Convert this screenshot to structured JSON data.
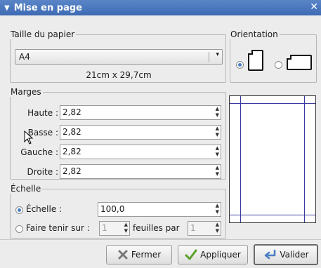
{
  "window": {
    "title": "Mise en page",
    "close_glyph": "✕"
  },
  "paper": {
    "group_label": "Taille du papier",
    "selected": "A4",
    "dimensions": "21cm x 29,7cm"
  },
  "orientation": {
    "group_label": "Orientation",
    "selected": "portrait"
  },
  "margins": {
    "group_label": "Marges",
    "items": [
      {
        "label": "Haute :",
        "value": "2,82"
      },
      {
        "label": "Basse :",
        "value": "2,82"
      },
      {
        "label": "Gauche :",
        "value": "2,82"
      },
      {
        "label": "Droite :",
        "value": "2,82"
      }
    ]
  },
  "scale": {
    "group_label": "Échelle",
    "option_scale_label": "Échelle :",
    "scale_value": "100,0",
    "option_fit_label": "Faire tenir sur :",
    "fit_wide_value": "1",
    "fit_middle_label": "feuilles par",
    "fit_tall_value": "1",
    "selected": "scale"
  },
  "buttons": {
    "close_label": "Fermer",
    "apply_label": "Appliquer",
    "ok_label": "Valider"
  },
  "icons": {
    "close": "close-icon",
    "apply": "checkmark-icon",
    "ok": "enter-arrow-icon",
    "cursor": "mouse-pointer-icon"
  },
  "colors": {
    "title_bar": "#4775bd",
    "radio_selected": "#4b7ec2",
    "margin_guides": "#3a3aa0"
  }
}
